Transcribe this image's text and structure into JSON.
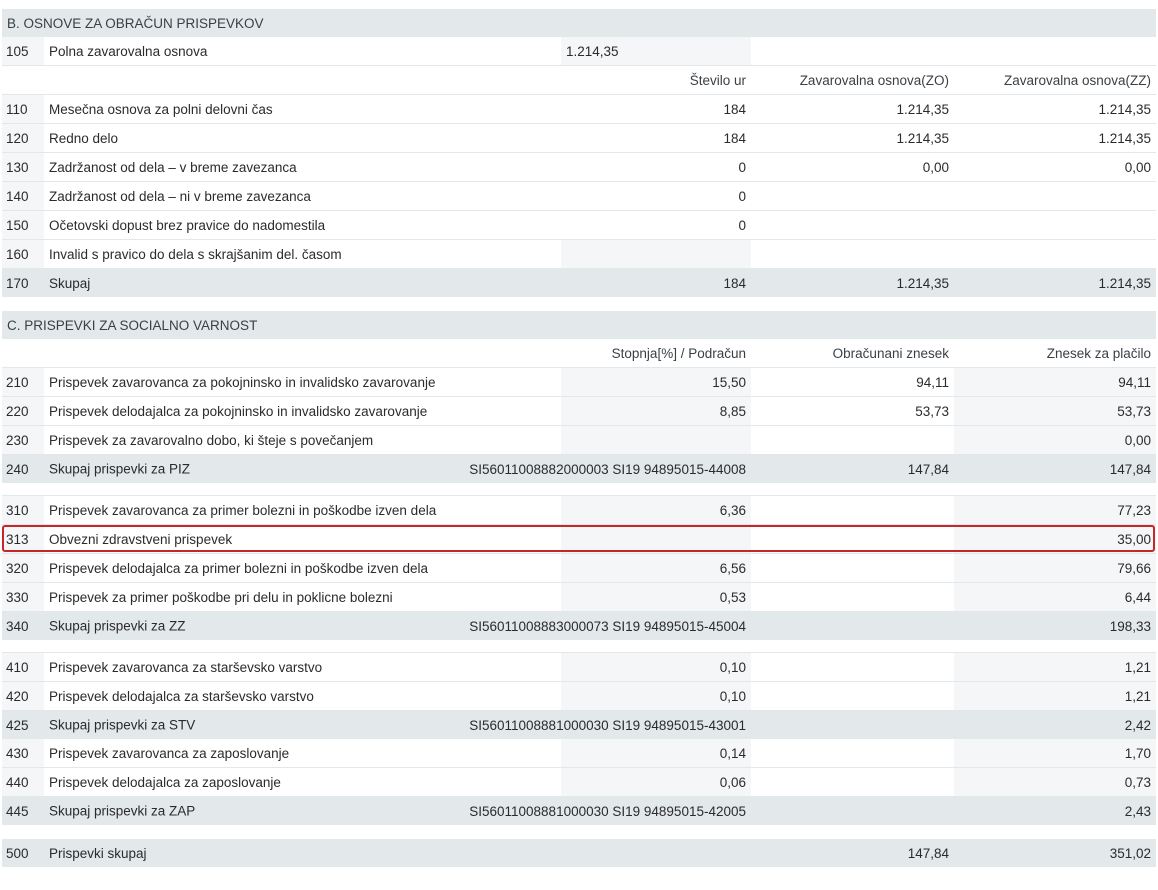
{
  "sectionB": {
    "title": "B. OSNOVE ZA OBRAČUN PRISPEVKOV",
    "row105": {
      "code": "105",
      "label": "Polna zavarovalna osnova",
      "value": "1.214,35"
    },
    "headers": [
      "Število ur",
      "Zavarovalna osnova(ZO)",
      "Zavarovalna osnova(ZZ)"
    ],
    "rows": [
      {
        "code": "110",
        "label": "Mesečna osnova za polni delovni čas",
        "hours": "184",
        "zo": "1.214,35",
        "zz": "1.214,35"
      },
      {
        "code": "120",
        "label": "Redno delo",
        "hours": "184",
        "zo": "1.214,35",
        "zz": "1.214,35"
      },
      {
        "code": "130",
        "label": "Zadržanost od dela – v breme zavezanca",
        "hours": "0",
        "zo": "0,00",
        "zz": "0,00"
      },
      {
        "code": "140",
        "label": "Zadržanost od dela – ni v breme zavezanca",
        "hours": "0",
        "zo": "",
        "zz": ""
      },
      {
        "code": "150",
        "label": "Očetovski dopust brez pravice do nadomestila",
        "hours": "0",
        "zo": "",
        "zz": ""
      },
      {
        "code": "160",
        "label": "Invalid s pravico do dela s skrajšanim del. časom",
        "hours": "",
        "zo": "",
        "zz": ""
      }
    ],
    "total": {
      "code": "170",
      "label": "Skupaj",
      "hours": "184",
      "zo": "1.214,35",
      "zz": "1.214,35"
    }
  },
  "sectionC": {
    "title": "C. PRISPEVKI ZA SOCIALNO VARNOST",
    "headers": [
      "Stopnja[%] / Podračun",
      "Obračunani znesek",
      "Znesek za plačilo"
    ],
    "piz": [
      {
        "code": "210",
        "label": "Prispevek zavarovanca za pokojninsko in invalidsko zavarovanje",
        "rate": "15,50",
        "calc": "94,11",
        "pay": "94,11"
      },
      {
        "code": "220",
        "label": "Prispevek delodajalca za pokojninsko in invalidsko zavarovanje",
        "rate": "8,85",
        "calc": "53,73",
        "pay": "53,73"
      },
      {
        "code": "230",
        "label": "Prispevek za zavarovalno dobo, ki šteje s povečanjem",
        "rate": "",
        "calc": "",
        "pay": "0,00"
      }
    ],
    "piz_total": {
      "code": "240",
      "label": "Skupaj prispevki za PIZ",
      "account": "SI56011008882000003 SI19 94895015-44008",
      "calc": "147,84",
      "pay": "147,84"
    },
    "zz": [
      {
        "code": "310",
        "label": "Prispevek zavarovanca za primer bolezni in poškodbe izven dela",
        "rate": "6,36",
        "calc": "",
        "pay": "77,23"
      },
      {
        "code": "313",
        "label": "Obvezni zdravstveni prispevek",
        "rate": "",
        "calc": "",
        "pay": "35,00"
      },
      {
        "code": "320",
        "label": "Prispevek delodajalca za primer bolezni in poškodbe izven dela",
        "rate": "6,56",
        "calc": "",
        "pay": "79,66"
      },
      {
        "code": "330",
        "label": "Prispevek za primer poškodbe pri delu in poklicne bolezni",
        "rate": "0,53",
        "calc": "",
        "pay": "6,44"
      }
    ],
    "zz_total": {
      "code": "340",
      "label": "Skupaj prispevki za ZZ",
      "account": "SI56011008883000073 SI19 94895015-45004",
      "calc": "",
      "pay": "198,33"
    },
    "stv": [
      {
        "code": "410",
        "label": "Prispevek zavarovanca za starševsko varstvo",
        "rate": "0,10",
        "calc": "",
        "pay": "1,21"
      },
      {
        "code": "420",
        "label": "Prispevek delodajalca za starševsko varstvo",
        "rate": "0,10",
        "calc": "",
        "pay": "1,21"
      }
    ],
    "stv_total": {
      "code": "425",
      "label": "Skupaj prispevki za STV",
      "account": "SI56011008881000030 SI19 94895015-43001",
      "calc": "",
      "pay": "2,42"
    },
    "zap": [
      {
        "code": "430",
        "label": "Prispevek zavarovanca za zaposlovanje",
        "rate": "0,14",
        "calc": "",
        "pay": "1,70"
      },
      {
        "code": "440",
        "label": "Prispevek delodajalca za zaposlovanje",
        "rate": "0,06",
        "calc": "",
        "pay": "0,73"
      }
    ],
    "zap_total": {
      "code": "445",
      "label": "Skupaj prispevki za ZAP",
      "account": "SI56011008881000030 SI19 94895015-42005",
      "calc": "",
      "pay": "2,43"
    },
    "grand_total": {
      "code": "500",
      "label": "Prispevki skupaj",
      "calc": "147,84",
      "pay": "351,02"
    }
  },
  "highlight_color": "#c62828"
}
